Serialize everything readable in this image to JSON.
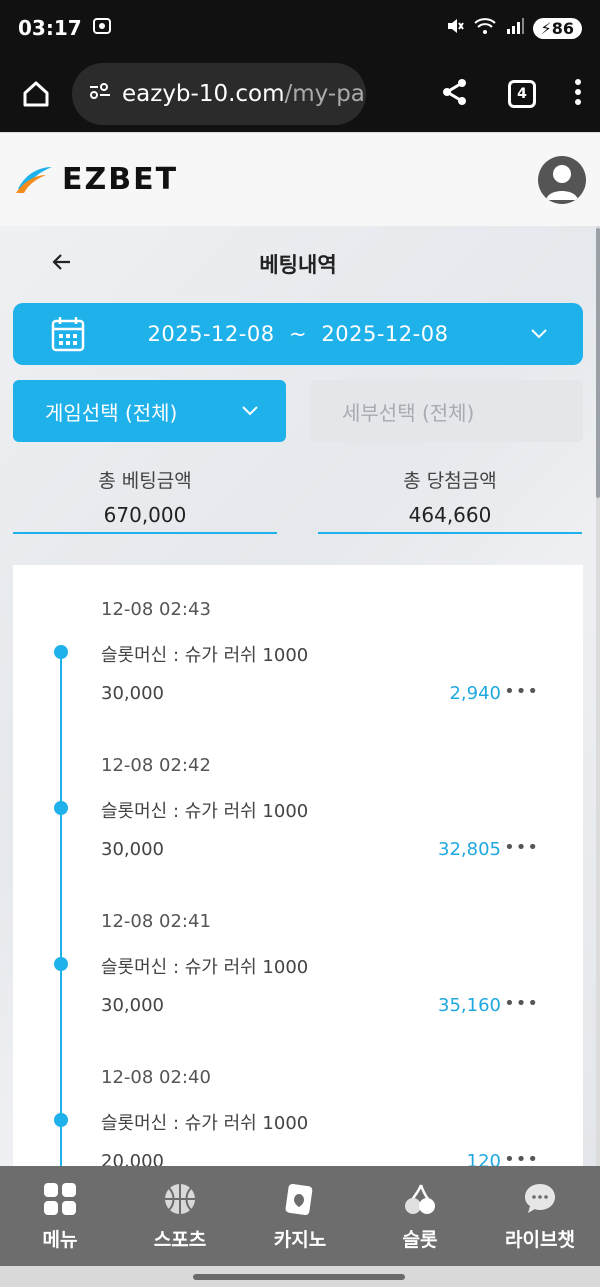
{
  "status_bar": {
    "time": "03:17",
    "battery": "86"
  },
  "browser": {
    "url_main": "eazyb-10.com",
    "url_rest": "/my-pa",
    "tab_count": "4"
  },
  "site": {
    "logo_text": "EZBET"
  },
  "page": {
    "title": "베팅내역"
  },
  "date_range": {
    "start": "2025-12-08",
    "separator": "~",
    "end": "2025-12-08"
  },
  "filters": {
    "game_select": "게임선택 (전체)",
    "sub_select": "세부선택 (전체)"
  },
  "totals": {
    "bet_label": "총 베팅금액",
    "bet_value": "670,000",
    "win_label": "총 당첨금액",
    "win_value": "464,660"
  },
  "history": [
    {
      "time": "12-08 02:43",
      "game": "슬롯머신 : 슈가 러쉬 1000",
      "bet": "30,000",
      "win": "2,940"
    },
    {
      "time": "12-08 02:42",
      "game": "슬롯머신 : 슈가 러쉬 1000",
      "bet": "30,000",
      "win": "32,805"
    },
    {
      "time": "12-08 02:41",
      "game": "슬롯머신 : 슈가 러쉬 1000",
      "bet": "30,000",
      "win": "35,160"
    },
    {
      "time": "12-08 02:40",
      "game": "슬롯머신 : 슈가 러쉬 1000",
      "bet": "20,000",
      "win": "120"
    }
  ],
  "more_glyph": "•••",
  "bottom_nav": [
    {
      "label": "메뉴",
      "icon": "menu-grid-icon"
    },
    {
      "label": "스포츠",
      "icon": "basketball-icon"
    },
    {
      "label": "카지노",
      "icon": "casino-card-icon"
    },
    {
      "label": "슬롯",
      "icon": "cherry-icon"
    },
    {
      "label": "라이브챗",
      "icon": "chat-bubble-icon"
    }
  ],
  "colors": {
    "accent": "#1fb1ea",
    "win_text": "#1fa8e0",
    "nav_bg": "#6d6d6d"
  }
}
